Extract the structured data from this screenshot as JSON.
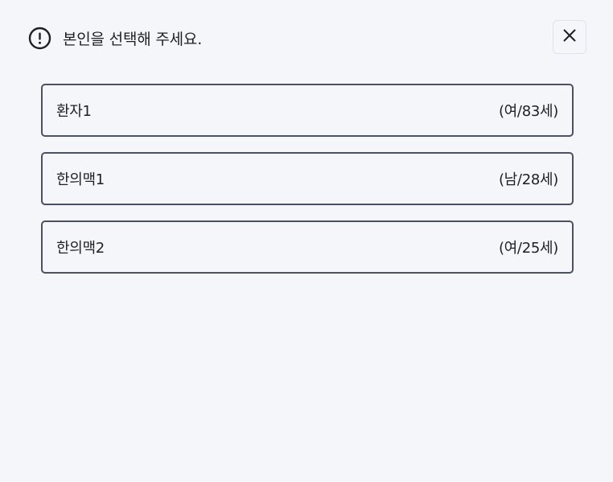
{
  "header": {
    "title": "본인을 선택해 주세요.",
    "alert_icon": "exclamation-circle-icon",
    "close_icon": "close-icon"
  },
  "patients": [
    {
      "name": "환자1",
      "info": "(여/83세)"
    },
    {
      "name": "한의맥1",
      "info": "(남/28세)"
    },
    {
      "name": "한의맥2",
      "info": "(여/25세)"
    }
  ],
  "colors": {
    "background": "#f4f6fa",
    "border": "#4b5063",
    "text": "#1f1f24"
  }
}
